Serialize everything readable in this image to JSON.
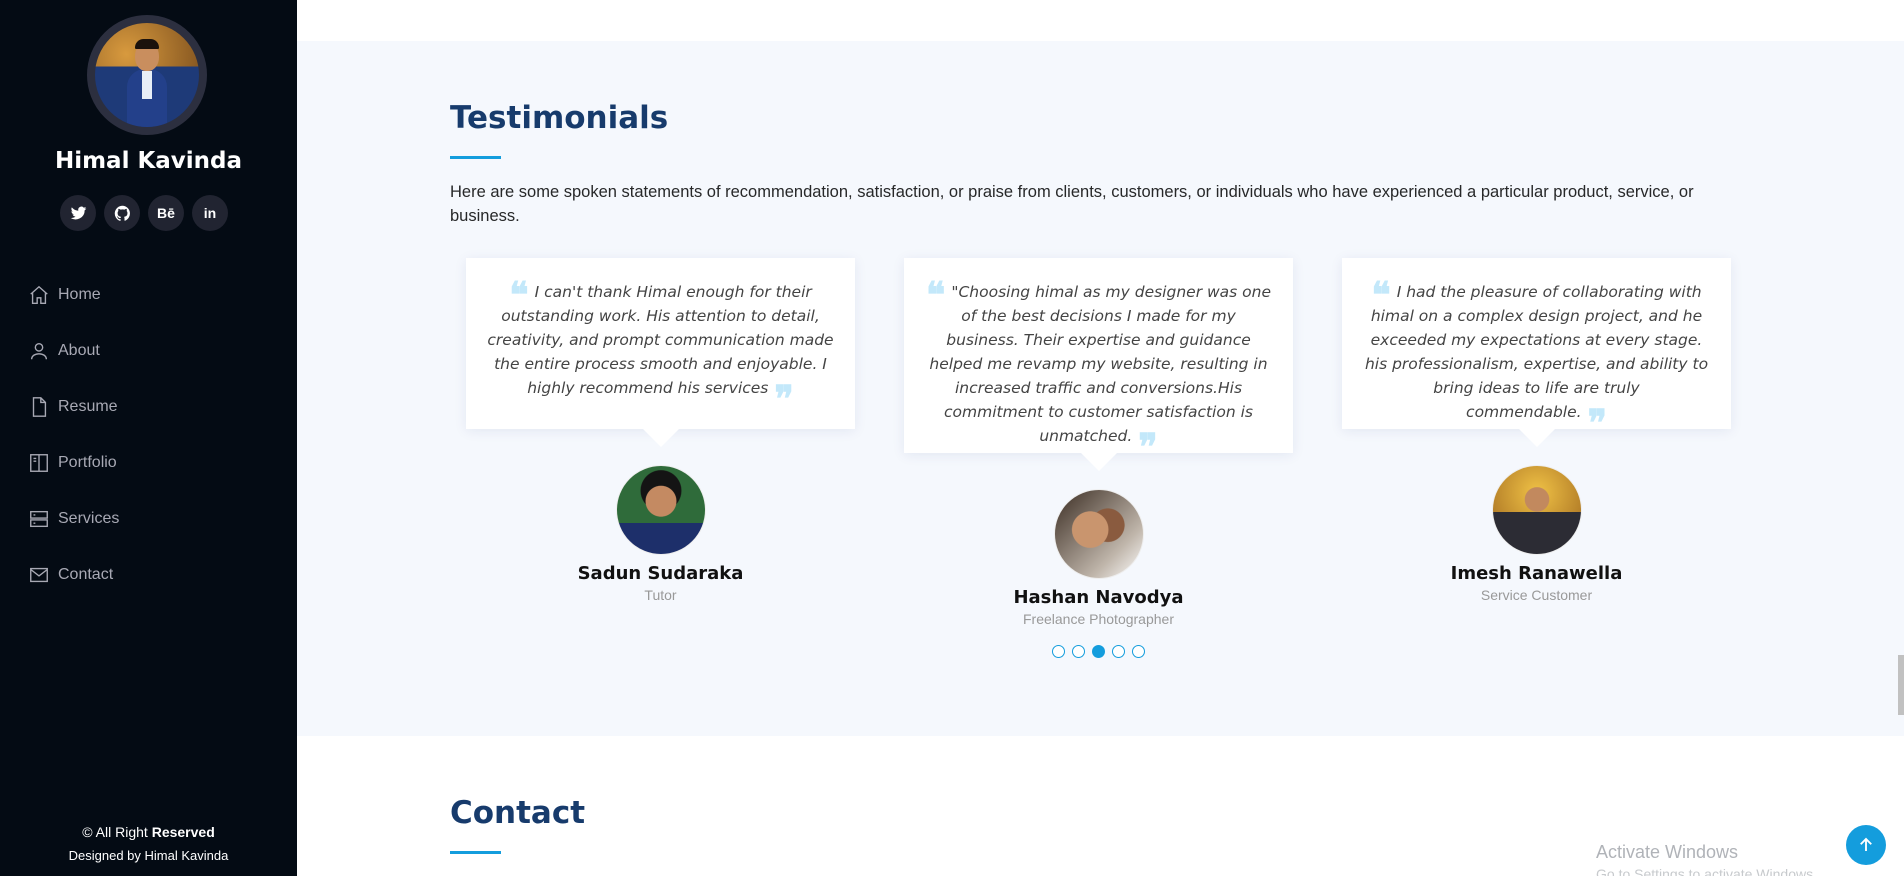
{
  "sidebar": {
    "profile_name": "Himal Kavinda",
    "social_links": [
      {
        "icon": "twitter-icon"
      },
      {
        "icon": "github-icon"
      },
      {
        "icon": "behance-icon",
        "text": "Bē"
      },
      {
        "icon": "linkedin-icon",
        "text": "in"
      }
    ],
    "nav": [
      {
        "label": "Home",
        "icon": "home-icon"
      },
      {
        "label": "About",
        "icon": "user-icon"
      },
      {
        "label": "Resume",
        "icon": "file-icon"
      },
      {
        "label": "Portfolio",
        "icon": "book-icon"
      },
      {
        "label": "Services",
        "icon": "server-icon"
      },
      {
        "label": "Contact",
        "icon": "envelope-icon"
      }
    ],
    "copyright_prefix": "© All Right ",
    "copyright_bold": "Reserved",
    "credits": "Designed by Himal Kavinda"
  },
  "testimonials": {
    "title": "Testimonials",
    "description": "Here are some spoken statements of recommendation, satisfaction, or praise from clients, customers, or individuals who have experienced a particular product, service, or business.",
    "items": [
      {
        "quote": "I can't thank Himal enough for their outstanding work. His attention to detail, creativity, and prompt communication made the entire process smooth and enjoyable. I highly recommend his services",
        "name": "Sadun Sudaraka",
        "role": "Tutor"
      },
      {
        "quote": "\"Choosing himal as my designer was one of the best decisions I made for my business. Their expertise and guidance helped me revamp my website, resulting in increased traffic and conversions.His commitment to customer satisfaction is unmatched.",
        "name": "Hashan Navodya",
        "role": "Freelance Photographer"
      },
      {
        "quote": "I had the pleasure of collaborating with himal on a complex design project, and he exceeded my expectations at every stage. his professionalism, expertise, and ability to bring ideas to life are truly commendable.",
        "name": "Imesh Ranawella",
        "role": "Service Customer"
      }
    ],
    "pagination": {
      "total": 5,
      "active": 3
    },
    "quote_open": "❝",
    "quote_close": "❞"
  },
  "contact": {
    "title": "Contact"
  },
  "os_overlay": {
    "title": "Activate Windows",
    "subtitle": "Go to Settings to activate Windows."
  },
  "colors": {
    "accent": "#149ddd",
    "sidebar_bg": "#040b14",
    "heading": "#173b6c"
  }
}
